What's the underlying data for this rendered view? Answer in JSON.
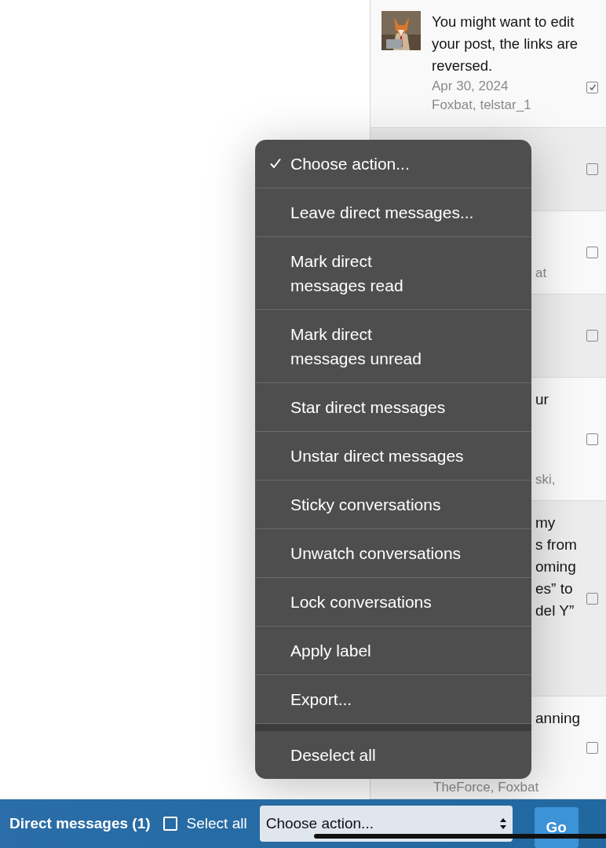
{
  "conversations": [
    {
      "kind": "full",
      "selected": true,
      "text": "You might want to edit your post, the links are reversed.",
      "date": "Apr 30, 2024",
      "participants": "Foxbat, telstar_1"
    },
    {
      "kind": "covered",
      "selected": false
    },
    {
      "kind": "covered",
      "selected": false,
      "lines": [
        {
          "kind": "meta",
          "text": "at"
        }
      ]
    },
    {
      "kind": "covered",
      "selected": false
    },
    {
      "kind": "covered",
      "selected": false,
      "lines": [
        {
          "kind": "title",
          "text": "ur"
        },
        {
          "kind": "meta",
          "text": "ski,"
        }
      ]
    },
    {
      "kind": "covered",
      "selected": false,
      "lines": [
        {
          "kind": "title",
          "text": "my"
        },
        {
          "kind": "title",
          "text": "s from"
        },
        {
          "kind": "title",
          "text": "oming"
        },
        {
          "kind": "title",
          "text": "es” to"
        },
        {
          "kind": "title",
          "text": "del Y”"
        }
      ]
    },
    {
      "kind": "covered",
      "selected": false,
      "lines": [
        {
          "kind": "title",
          "text": "anning"
        },
        {
          "kind": "meta_full",
          "text": "TheForce, Foxbat"
        }
      ]
    }
  ],
  "action_menu": [
    {
      "kind": "action",
      "label": "Choose action...",
      "selected": true
    },
    {
      "kind": "action",
      "label": "Leave direct messages...",
      "selected": false
    },
    {
      "kind": "action",
      "label": "Mark direct\nmessages read",
      "selected": false
    },
    {
      "kind": "action",
      "label": "Mark direct\nmessages unread",
      "selected": false
    },
    {
      "kind": "action",
      "label": "Star direct messages",
      "selected": false
    },
    {
      "kind": "action",
      "label": "Unstar direct messages",
      "selected": false
    },
    {
      "kind": "action",
      "label": "Sticky conversations",
      "selected": false
    },
    {
      "kind": "action",
      "label": "Unwatch conversations",
      "selected": false
    },
    {
      "kind": "action",
      "label": "Lock conversations",
      "selected": false
    },
    {
      "kind": "action",
      "label": "Apply label",
      "selected": false
    },
    {
      "kind": "action",
      "label": "Export...",
      "selected": false
    },
    {
      "kind": "separator"
    },
    {
      "kind": "action",
      "label": "Deselect all",
      "selected": false
    }
  ],
  "footer": {
    "title": "Direct messages (1)",
    "select_all": {
      "label": "Select all",
      "checked": false
    },
    "action_select": {
      "value": "Choose action..."
    },
    "go_button": "Go"
  }
}
